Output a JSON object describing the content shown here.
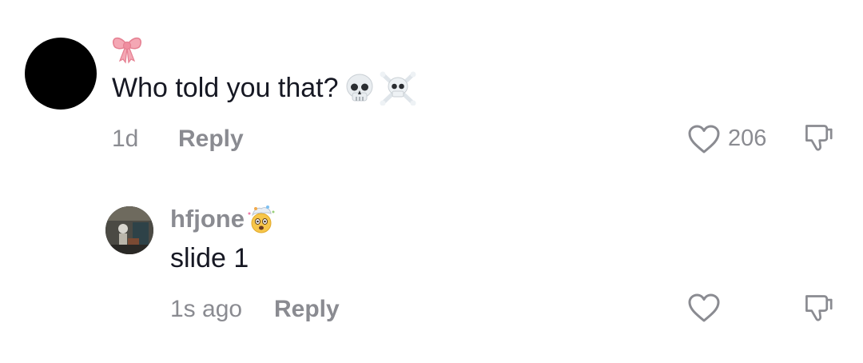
{
  "comment": {
    "text": "Who told you that?",
    "time": "1d",
    "reply_label": "Reply",
    "like_count": "206",
    "icons": [
      "ribbon-icon",
      "skull-icon",
      "skull-crossbones-icon"
    ]
  },
  "reply": {
    "username": "hfjone",
    "text": "slide 1",
    "time": "1s ago",
    "reply_label": "Reply",
    "icons": [
      "exploding-head-icon"
    ]
  },
  "colors": {
    "text": "#161823",
    "meta": "#8a8b91",
    "avatar": "#000000"
  }
}
